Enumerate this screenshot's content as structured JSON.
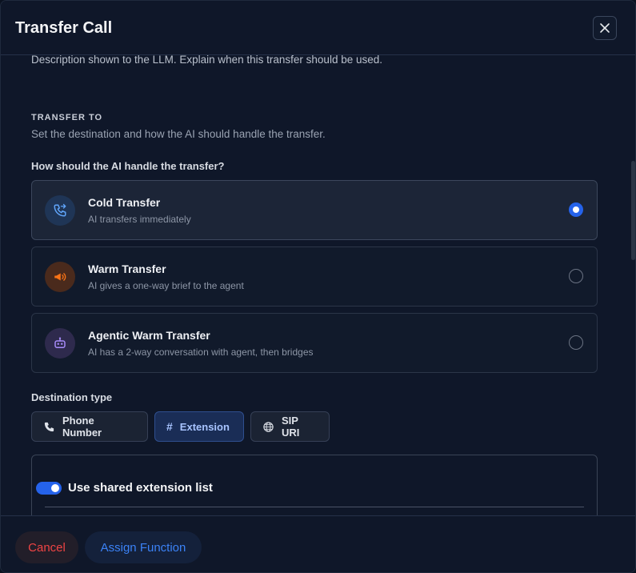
{
  "dialog": {
    "title": "Transfer Call"
  },
  "description_help": "Description shown to the LLM. Explain when this transfer should be used.",
  "transfer_to": {
    "heading": "TRANSFER TO",
    "subheading": "Set the destination and how the AI should handle the transfer.",
    "question": "How should the AI handle the transfer?",
    "options": [
      {
        "title": "Cold Transfer",
        "subtitle": "AI transfers immediately",
        "selected": true,
        "icon": "phone-transfer-icon",
        "color": "#60a5fa"
      },
      {
        "title": "Warm Transfer",
        "subtitle": "AI gives a one-way brief to the agent",
        "selected": false,
        "icon": "megaphone-icon",
        "color": "#f97316"
      },
      {
        "title": "Agentic Warm Transfer",
        "subtitle": "AI has a 2-way conversation with agent, then bridges",
        "selected": false,
        "icon": "robot-icon",
        "color": "#a78bfa"
      }
    ]
  },
  "destination": {
    "label": "Destination type",
    "types": [
      {
        "label": "Phone Number",
        "icon": "phone-icon",
        "active": false
      },
      {
        "label": "Extension",
        "icon": "hash-icon",
        "active": true
      },
      {
        "label": "SIP URI",
        "icon": "globe-icon",
        "active": false
      }
    ]
  },
  "extension": {
    "toggle_label": "Use shared extension list",
    "toggle_on": true
  },
  "footer": {
    "cancel_label": "Cancel",
    "assign_label": "Assign Function"
  },
  "colors": {
    "accent": "#2563eb",
    "danger": "#ef4444"
  }
}
